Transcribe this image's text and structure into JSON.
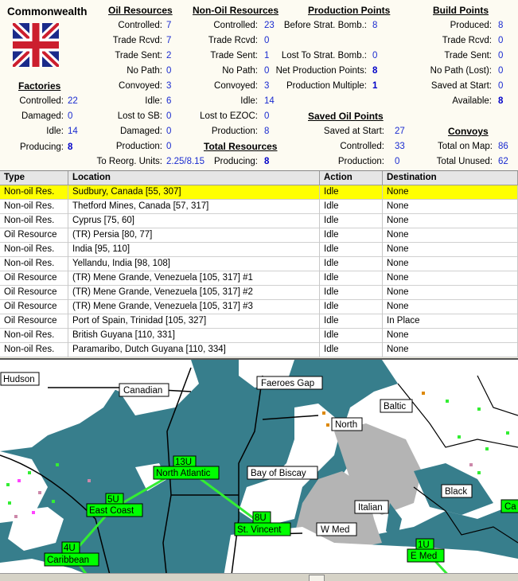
{
  "faction": "Commonwealth",
  "factories": {
    "title": "Factories",
    "rows": [
      {
        "label": "Controlled:",
        "value": "22"
      },
      {
        "label": "Damaged:",
        "value": "0"
      },
      {
        "label": "Idle:",
        "value": "14"
      },
      {
        "label": "Producing:",
        "value": "8"
      }
    ]
  },
  "oil": {
    "title": "Oil Resources",
    "rows": [
      {
        "label": "Controlled:",
        "value": "7"
      },
      {
        "label": "Trade Rcvd:",
        "value": "7"
      },
      {
        "label": "Trade Sent:",
        "value": "2"
      },
      {
        "label": "No Path:",
        "value": "0"
      },
      {
        "label": "Convoyed:",
        "value": "3"
      },
      {
        "label": "Idle:",
        "value": "6"
      },
      {
        "label": "Lost to SB:",
        "value": "0"
      },
      {
        "label": "Damaged:",
        "value": "0"
      },
      {
        "label": "Production:",
        "value": "0"
      },
      {
        "label": "To Reorg. Units:",
        "value": "2.25/8.15"
      }
    ]
  },
  "nonoil": {
    "title": "Non-Oil Resources",
    "rows": [
      {
        "label": "Controlled:",
        "value": "23"
      },
      {
        "label": "Trade Rcvd:",
        "value": "0"
      },
      {
        "label": "Trade Sent:",
        "value": "1"
      },
      {
        "label": "No Path:",
        "value": "0"
      },
      {
        "label": "Convoyed:",
        "value": "3"
      },
      {
        "label": "Idle:",
        "value": "14"
      },
      {
        "label": "Lost to EZOC:",
        "value": "0"
      },
      {
        "label": "Production:",
        "value": "8"
      }
    ]
  },
  "total": {
    "title": "Total Resources",
    "label": "Producing:",
    "value": "8"
  },
  "production": {
    "title": "Production Points",
    "rows": [
      {
        "label": "Before Strat. Bomb.:",
        "value": "8"
      },
      {
        "label": "Lost To Strat. Bomb.:",
        "value": "0"
      },
      {
        "label": "Net Production Points:",
        "value": "8"
      },
      {
        "label": "Production Multiple:",
        "value": "1"
      }
    ]
  },
  "saved_oil": {
    "title": "Saved Oil Points",
    "rows": [
      {
        "label": "Saved at Start:",
        "value": "27"
      },
      {
        "label": "Controlled:",
        "value": "33"
      },
      {
        "label": "Production:",
        "value": "0"
      }
    ]
  },
  "build": {
    "title": "Build Points",
    "rows": [
      {
        "label": "Produced:",
        "value": "8"
      },
      {
        "label": "Trade Rcvd:",
        "value": "0"
      },
      {
        "label": "Trade Sent:",
        "value": "0"
      },
      {
        "label": "No Path (Lost):",
        "value": "0"
      },
      {
        "label": "Saved at Start:",
        "value": "0"
      },
      {
        "label": "Available:",
        "value": "8"
      }
    ]
  },
  "convoys": {
    "title": "Convoys",
    "rows": [
      {
        "label": "Total on Map:",
        "value": "86"
      },
      {
        "label": "Total Unused:",
        "value": "62"
      }
    ]
  },
  "table": {
    "headers": [
      "Type",
      "Location",
      "Action",
      "Destination"
    ],
    "rows": [
      [
        "Non-oil Res.",
        "Sudbury, Canada [55, 307]",
        "Idle",
        "None"
      ],
      [
        "Non-oil Res.",
        "Thetford Mines, Canada [57, 317]",
        "Idle",
        "None"
      ],
      [
        "Non-oil Res.",
        "Cyprus [75, 60]",
        "Idle",
        "None"
      ],
      [
        "Oil Resource",
        "(TR) Persia [80, 77]",
        "Idle",
        "None"
      ],
      [
        "Non-oil Res.",
        "India [95, 110]",
        "Idle",
        "None"
      ],
      [
        "Non-oil Res.",
        "Yellandu, India [98, 108]",
        "Idle",
        "None"
      ],
      [
        "Oil Resource",
        "(TR) Mene Grande, Venezuela [105, 317] #1",
        "Idle",
        "None"
      ],
      [
        "Oil Resource",
        "(TR) Mene Grande, Venezuela [105, 317] #2",
        "Idle",
        "None"
      ],
      [
        "Oil Resource",
        "(TR) Mene Grande, Venezuela [105, 317] #3",
        "Idle",
        "None"
      ],
      [
        "Oil Resource",
        "Port of Spain, Trinidad [105, 327]",
        "Idle",
        "In Place"
      ],
      [
        "Non-oil Res.",
        "British Guyana [110, 331]",
        "Idle",
        "None"
      ],
      [
        "Non-oil Res.",
        "Paramaribo, Dutch Guyana [110, 334]",
        "Idle",
        "None"
      ]
    ]
  },
  "map": {
    "regions": [
      "Hudson",
      "Canadian",
      "Faeroes Gap",
      "Baltic",
      "North",
      "Bay of Biscay",
      "Black",
      "Italian",
      "W Med"
    ],
    "convoys": [
      {
        "count": "13U",
        "name": "North Atlantic"
      },
      {
        "count": "5U",
        "name": "East Coast"
      },
      {
        "count": "8U",
        "name": "St. Vincent"
      },
      {
        "count": "4U",
        "name": "Caribbean"
      },
      {
        "count": "1U",
        "name": "E Med"
      },
      {
        "count": "",
        "name": "Ca"
      }
    ]
  },
  "colors": {
    "sea": "#377e8c",
    "land": "#ffffff",
    "neutral": "#b4b4b4",
    "convoy": "#00ff00",
    "highlight": "#ffff00"
  }
}
